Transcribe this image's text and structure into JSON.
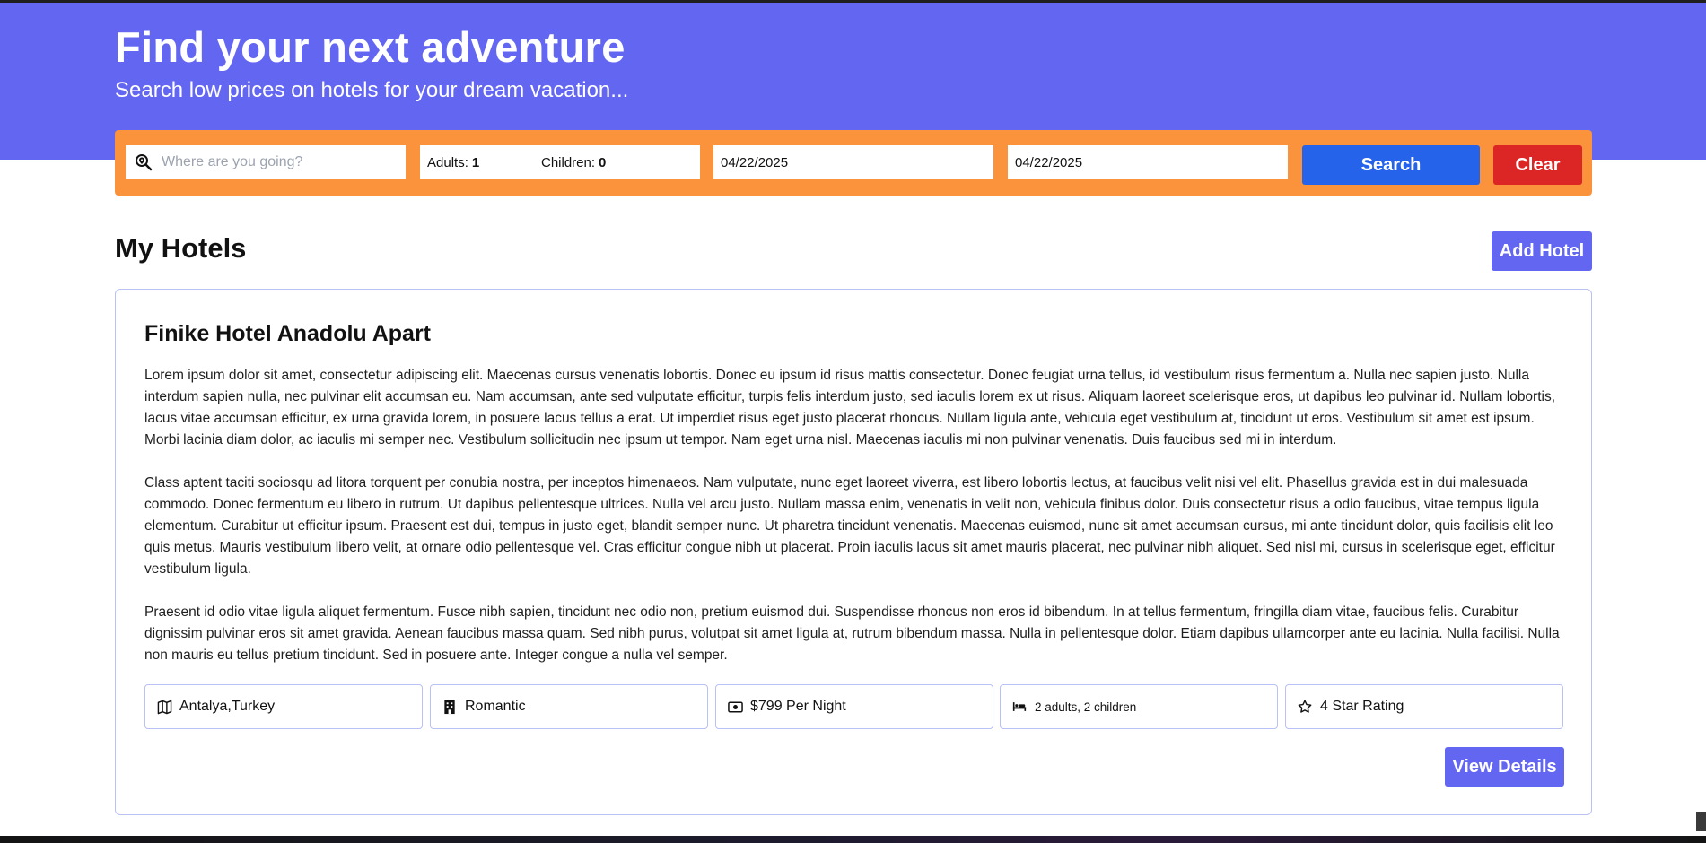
{
  "hero": {
    "title": "Find your next adventure",
    "subtitle": "Search low prices on hotels for your dream vacation..."
  },
  "search": {
    "destination_placeholder": "Where are you going?",
    "destination_value": "",
    "adults_label": "Adults:",
    "adults_value": "1",
    "children_label": "Children:",
    "children_value": "0",
    "check_in": "04/22/2025",
    "check_out": "04/22/2025",
    "search_label": "Search",
    "clear_label": "Clear"
  },
  "section": {
    "title": "My Hotels",
    "add_label": "Add Hotel"
  },
  "hotel": {
    "name": "Finike Hotel Anadolu Apart",
    "description": [
      "Lorem ipsum dolor sit amet, consectetur adipiscing elit. Maecenas cursus venenatis lobortis. Donec eu ipsum id risus mattis consectetur. Donec feugiat urna tellus, id vestibulum risus fermentum a. Nulla nec sapien justo. Nulla interdum sapien nulla, nec pulvinar elit accumsan eu. Nam accumsan, ante sed vulputate efficitur, turpis felis interdum justo, sed iaculis lorem ex ut risus. Aliquam laoreet scelerisque eros, ut dapibus leo pulvinar id. Nullam lobortis, lacus vitae accumsan efficitur, ex urna gravida lorem, in posuere lacus tellus a erat. Ut imperdiet risus eget justo placerat rhoncus. Nullam ligula ante, vehicula eget vestibulum at, tincidunt ut eros. Vestibulum sit amet est ipsum. Morbi lacinia diam dolor, ac iaculis mi semper nec. Vestibulum sollicitudin nec ipsum ut tempor. Nam eget urna nisl. Maecenas iaculis mi non pulvinar venenatis. Duis faucibus sed mi in interdum.",
      "Class aptent taciti sociosqu ad litora torquent per conubia nostra, per inceptos himenaeos. Nam vulputate, nunc eget laoreet viverra, est libero lobortis lectus, at faucibus velit nisi vel elit. Phasellus gravida est in dui malesuada commodo. Donec fermentum eu libero in rutrum. Ut dapibus pellentesque ultrices. Nulla vel arcu justo. Nullam massa enim, venenatis in velit non, vehicula finibus dolor. Duis consectetur risus a odio faucibus, vitae tempus ligula elementum. Curabitur ut efficitur ipsum. Praesent est dui, tempus in justo eget, blandit semper nunc. Ut pharetra tincidunt venenatis. Maecenas euismod, nunc sit amet accumsan cursus, mi ante tincidunt dolor, quis facilisis elit leo quis metus. Mauris vestibulum libero velit, at ornare odio pellentesque vel. Cras efficitur congue nibh ut placerat. Proin iaculis lacus sit amet mauris placerat, nec pulvinar nibh aliquet. Sed nisl mi, cursus in scelerisque eget, efficitur vestibulum ligula.",
      "Praesent id odio vitae ligula aliquet fermentum. Fusce nibh sapien, tincidunt nec odio non, pretium euismod dui. Suspendisse rhoncus non eros id bibendum. In at tellus fermentum, fringilla diam vitae, faucibus felis. Curabitur dignissim pulvinar eros sit amet gravida. Aenean faucibus massa quam. Sed nibh purus, volutpat sit amet ligula at, rutrum bibendum massa. Nulla in pellentesque dolor. Etiam dapibus ullamcorper ante eu lacinia. Nulla facilisi. Nulla non mauris eu tellus pretium tincidunt. Sed in posuere ante. Integer congue a nulla vel semper."
    ],
    "chips": [
      {
        "icon": "map-icon",
        "text": "Antalya,Turkey"
      },
      {
        "icon": "building-icon",
        "text": "Romantic"
      },
      {
        "icon": "money-icon",
        "text": "$799 Per Night"
      },
      {
        "icon": "bed-icon",
        "text": "2 adults, 2 children"
      },
      {
        "icon": "star-icon",
        "text": "4 Star Rating"
      }
    ],
    "view_label": "View Details"
  },
  "colors": {
    "hero_bg": "#6366f1",
    "search_bar_bg": "#fb923c",
    "search_button": "#2563eb",
    "clear_button": "#dc2626",
    "accent_button": "#6366f1"
  }
}
